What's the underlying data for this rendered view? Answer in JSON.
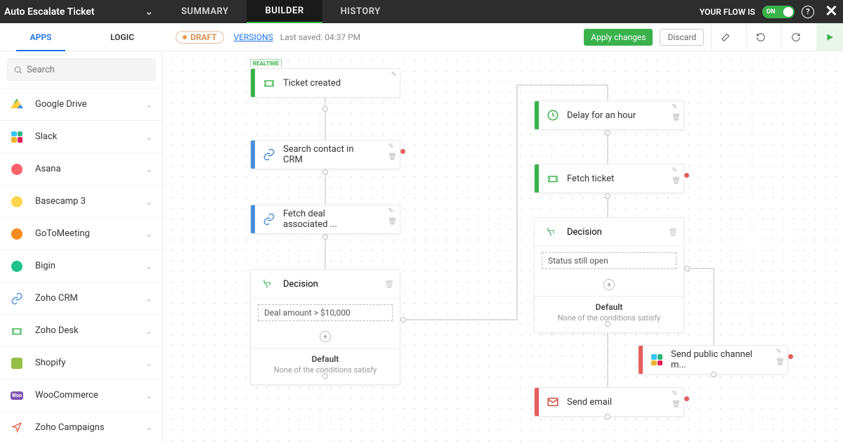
{
  "header": {
    "flow_title": "Auto Escalate Ticket",
    "tabs": [
      "SUMMARY",
      "BUILDER",
      "HISTORY"
    ],
    "active_tab_index": 1,
    "flow_status_label": "YOUR FLOW IS",
    "toggle_label": "ON"
  },
  "subbar": {
    "tabs": [
      "APPS",
      "LOGIC"
    ],
    "active_index": 0,
    "draft_label": "DRAFT",
    "versions_label": "VERSIONS",
    "last_saved": "Last saved: 04:37 PM",
    "apply_label": "Apply changes",
    "discard_label": "Discard"
  },
  "search": {
    "placeholder": "Search"
  },
  "apps": [
    {
      "label": "Google Drive"
    },
    {
      "label": "Slack"
    },
    {
      "label": "Asana"
    },
    {
      "label": "Basecamp 3"
    },
    {
      "label": "GoToMeeting"
    },
    {
      "label": "Bigin"
    },
    {
      "label": "Zoho CRM"
    },
    {
      "label": "Zoho Desk"
    },
    {
      "label": "Shopify"
    },
    {
      "label": "WooCommerce"
    },
    {
      "label": "Zoho Campaigns"
    }
  ],
  "nodes": {
    "n1": {
      "label": "Ticket created",
      "realtime": "REALTIME"
    },
    "n2": {
      "label": "Search contact in CRM"
    },
    "n3": {
      "label": "Fetch deal associated ..."
    },
    "n4": {
      "label": "Decision",
      "condition": "Deal amount > $10,000",
      "default_title": "Default",
      "default_sub": "None of the conditions satisfy"
    },
    "n5": {
      "label": "Delay for an hour"
    },
    "n6": {
      "label": "Fetch ticket"
    },
    "n7": {
      "label": "Decision",
      "condition": "Status still open",
      "default_title": "Default",
      "default_sub": "None of the conditions satisfy"
    },
    "n8": {
      "label": "Send public channel m..."
    },
    "n9": {
      "label": "Send email"
    }
  }
}
